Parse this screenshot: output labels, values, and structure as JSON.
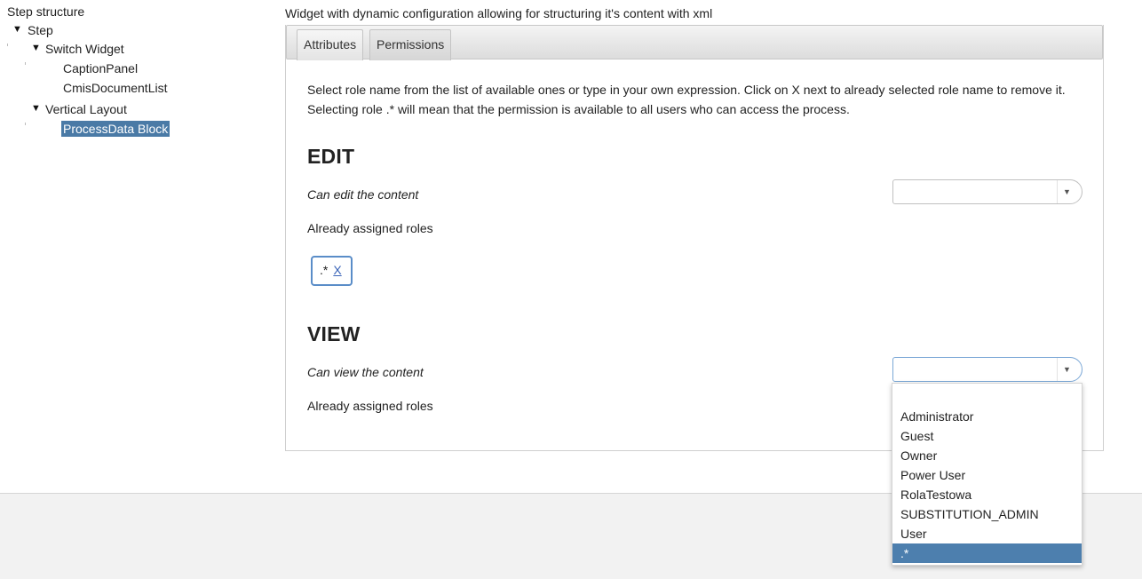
{
  "tree": {
    "root_label": "Step structure",
    "step": "Step",
    "switch_widget": "Switch Widget",
    "caption_panel": "CaptionPanel",
    "cmis_document_list": "CmisDocumentList",
    "vertical_layout": "Vertical Layout",
    "process_data_block": "ProcessData Block",
    "selected": "ProcessData Block"
  },
  "widget": {
    "description": "Widget with dynamic configuration allowing for structuring it's content with xml"
  },
  "tabs": [
    {
      "label": "Attributes",
      "active": false
    },
    {
      "label": "Permissions",
      "active": true
    }
  ],
  "permissions": {
    "intro": "Select role name from the list of available ones or type in your own expression. Click on X next to already selected role name to remove it. Selecting role .* will mean that the permission is available to all users who can access the process.",
    "edit": {
      "heading": "EDIT",
      "label": "Can edit the content",
      "select_value": "",
      "assigned_label": "Already assigned roles",
      "assigned_roles": [
        {
          "name": ".*",
          "remove": "X"
        }
      ]
    },
    "view": {
      "heading": "VIEW",
      "label": "Can view the content",
      "select_value": "",
      "assigned_label": "Already assigned roles"
    }
  },
  "dropdown": {
    "options": [
      "",
      "Administrator",
      "Guest",
      "Owner",
      "Power User",
      "RolaTestowa",
      "SUBSTITUTION_ADMIN",
      "User",
      ".*"
    ],
    "highlighted": ".*"
  },
  "colors": {
    "selection": "#4a7aa6",
    "highlight": "#4d7fae",
    "link": "#3a64b8"
  },
  "icons": {
    "expand": "triangle-down",
    "select_caret": "caret-down"
  }
}
